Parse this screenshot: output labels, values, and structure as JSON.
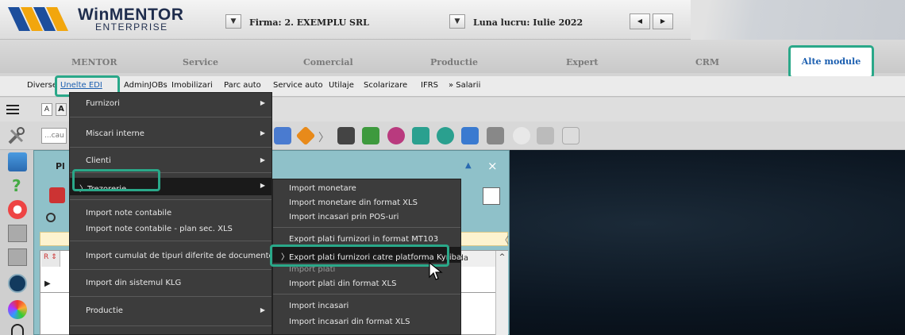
{
  "topbar": {
    "logo_main": "WinMENTOR",
    "logo_sub": "ENTERPRISE",
    "firma_label": "Firma:  2. EXEMPLU SRL",
    "luna_label": "Luna lucru:  Iulie 2022",
    "nav_prev": "◀",
    "nav_next": "▶",
    "dropdown_glyph": "▼"
  },
  "modules": [
    "MENTOR",
    "Service",
    "Comercial",
    "Productie",
    "Expert",
    "CRM",
    "Alte module"
  ],
  "submenu": [
    "Diverse",
    "Unelte EDI",
    "AdminJOBs",
    "Imobilizari",
    "Parc auto",
    "Service auto",
    "Utilaje",
    "Scolarizare",
    "IFRS",
    "» Salarii"
  ],
  "toolbar": {
    "font_a1": "A",
    "font_a2": "A",
    "search_placeholder": "...cau"
  },
  "dialog": {
    "title": "Pl",
    "col_header": "neda",
    "close": "×",
    "minimize": "▲"
  },
  "main_menu": {
    "items": [
      {
        "label": "Furnizori",
        "arrow": true
      },
      {
        "label": "Miscari interne",
        "arrow": true
      },
      {
        "label": "Clienti",
        "arrow": true
      },
      {
        "label": "Trezorerie",
        "arrow": true,
        "selected": true
      },
      {
        "label": "Import note contabile",
        "arrow": false
      },
      {
        "label": "Import note contabile - plan sec. XLS",
        "arrow": false
      },
      {
        "label": "Import cumulat de tipuri diferite de documente",
        "arrow": false
      },
      {
        "label": "Import din sistemul KLG",
        "arrow": false
      },
      {
        "label": "Productie",
        "arrow": true
      }
    ]
  },
  "trezorerie_menu": {
    "items": [
      "Import monetare",
      "Import monetare din format XLS",
      "Import incasari prin POS-uri",
      "Export plati furnizori in format MT103",
      "Export plati furnizori catre platforma Kyriba",
      "Import plati",
      "Import plati din format XLS",
      "Import incasari",
      "Import incasari din format XLS"
    ],
    "selected_index": 4
  },
  "colors": {
    "accent_green": "#2aa889",
    "menu_bg": "#3c3c3c",
    "active_module_text": "#1c5fb0"
  }
}
